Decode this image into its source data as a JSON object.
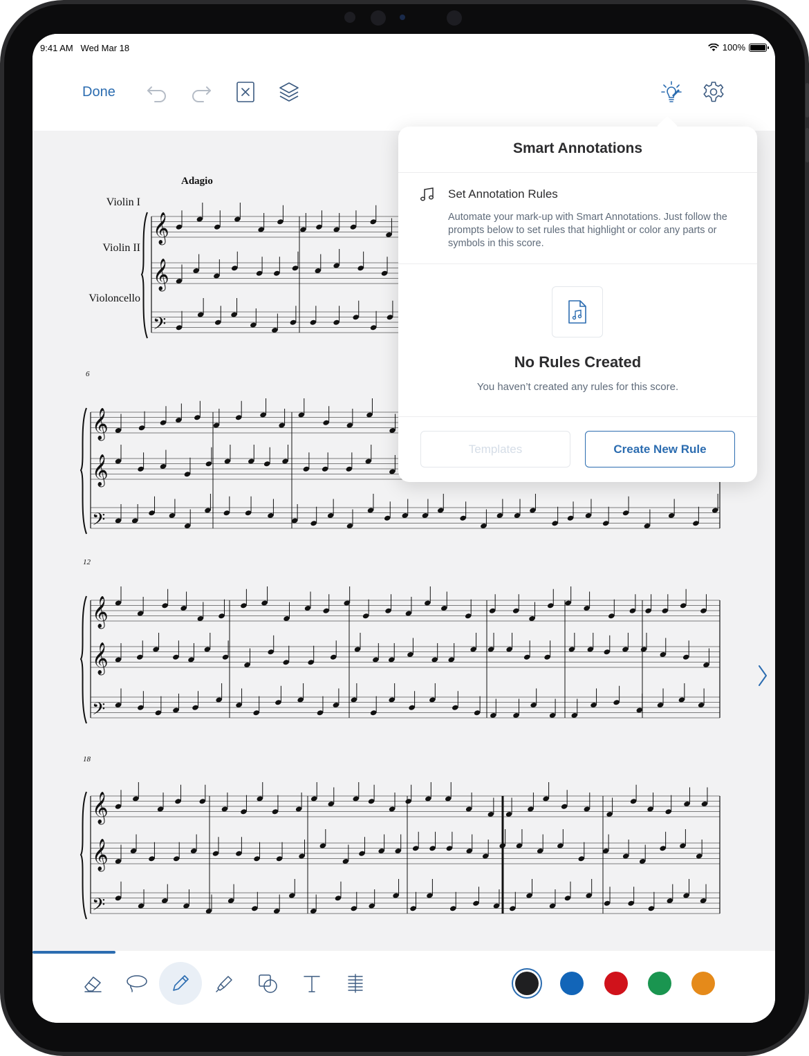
{
  "status_bar": {
    "time": "9:41 AM",
    "date": "Wed Mar 18",
    "battery": "100%"
  },
  "toolbar": {
    "done_label": "Done",
    "icons": [
      "undo-icon",
      "redo-icon",
      "close-box-icon",
      "layers-icon",
      "smart-annotations-icon",
      "gear-icon"
    ]
  },
  "score": {
    "tempo": "Adagio",
    "instruments": [
      "Violin I",
      "Violin II",
      "Violoncello"
    ],
    "measure_numbers": [
      "6",
      "12",
      "18"
    ]
  },
  "popover": {
    "title": "Smart Annotations",
    "rule_heading": "Set Annotation Rules",
    "rule_description": "Automate your mark-up with Smart Annotations. Just follow the prompts below to set rules that highlight or color any parts or symbols in this score.",
    "empty_title": "No Rules Created",
    "empty_subtitle": "You haven’t created any rules for this score.",
    "templates_label": "Templates",
    "create_label": "Create New Rule"
  },
  "bottom_toolbar": {
    "tools": [
      "eraser-icon",
      "lasso-icon",
      "pen-icon",
      "highlighter-icon",
      "shapes-icon",
      "text-icon",
      "staff-lines-icon"
    ],
    "active_tool": "pen-icon",
    "colors": [
      "#1f1f21",
      "#1265b8",
      "#d0121b",
      "#1a9550",
      "#e58a1a"
    ],
    "selected_color": "#1f1f21",
    "accent": "#2b6cb0"
  }
}
